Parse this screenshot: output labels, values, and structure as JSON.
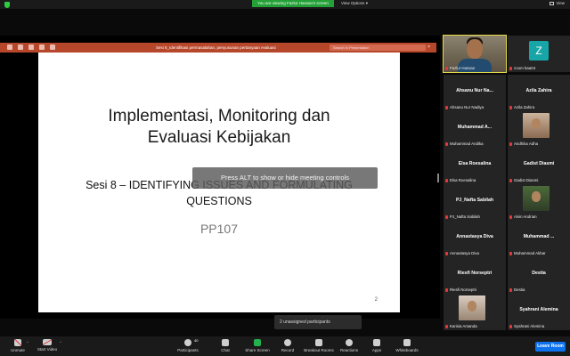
{
  "top_bar": {
    "viewing_text": "You are viewing Fazlur Hassan's screen",
    "view_options_label": "View Options",
    "view_label": "View"
  },
  "powerpoint": {
    "window_title": "Sesi 8_Identifikasi permasalahan, penyusunan pertanyaan evaluasi",
    "search_placeholder": "Search in Presentation"
  },
  "slide": {
    "title_line1": "Implementasi, Monitoring dan",
    "title_line2": "Evaluasi Kebijakan",
    "subtitle_line1": "Sesi 8 – IDENTIFYING ISSUES AND FORMULATING",
    "subtitle_line2": "QUESTIONS",
    "code": "PP107",
    "page_number": "2"
  },
  "overlay_tip": "Press ALT to show or hide meeting controls",
  "participants": [
    {
      "name_label": "Fazlur Hassan",
      "display": "",
      "type": "video-man"
    },
    {
      "name_label": "zoom baa04",
      "display": "",
      "type": "avatar-z"
    },
    {
      "name_label": "Ahsanu Nur Nadiya",
      "display": "Ahsanu Nur Na...",
      "type": "name"
    },
    {
      "name_label": "Azila Zahira",
      "display": "Azila Zahira",
      "type": "name"
    },
    {
      "name_label": "Muhammad Andika",
      "display": "Muhammad A...",
      "type": "name"
    },
    {
      "name_label": "Andhika Adha",
      "display": "",
      "type": "photo-a"
    },
    {
      "name_label": "Elsa Roesalina",
      "display": "Elsa Roesalina",
      "type": "name"
    },
    {
      "name_label": "Gadist Diasmi",
      "display": "Gadist Diasmi",
      "type": "name"
    },
    {
      "name_label": "PJ_Nafta Sabilah",
      "display": "PJ_Nafta Sabilah",
      "type": "name"
    },
    {
      "name_label": "Alvin Andrian",
      "display": "",
      "type": "photo-b"
    },
    {
      "name_label": "Annastasya Diva",
      "display": "Annastasya Diva",
      "type": "name"
    },
    {
      "name_label": "Muhammad Akbar",
      "display": "Muhammad ...",
      "type": "name"
    },
    {
      "name_label": "Riesfi Norseptri",
      "display": "Riesfi Norseptri",
      "type": "name"
    },
    {
      "name_label": "Destia",
      "display": "Destia",
      "type": "name"
    },
    {
      "name_label": "Karisia Amanda",
      "display": "",
      "type": "photo-c"
    },
    {
      "name_label": "Syahrani Alemina",
      "display": "Syahrani Alemina",
      "type": "name"
    }
  ],
  "unassigned_text": "2 unassigned participants",
  "toolbar": {
    "unmute": "Unmute",
    "start_video": "Start Video",
    "participants": "Participants",
    "participants_count": "40",
    "chat": "Chat",
    "share_screen": "Share Screen",
    "record": "Record",
    "breakout_rooms": "Breakout Rooms",
    "reactions": "Reactions",
    "apps": "Apps",
    "whiteboards": "Whiteboards",
    "leave": "Leave Room"
  },
  "colors": {
    "share_green": "#23a036",
    "ppt_red": "#b7472a",
    "leave_blue": "#0e72ed",
    "active_speaker": "#e6dc4b"
  }
}
